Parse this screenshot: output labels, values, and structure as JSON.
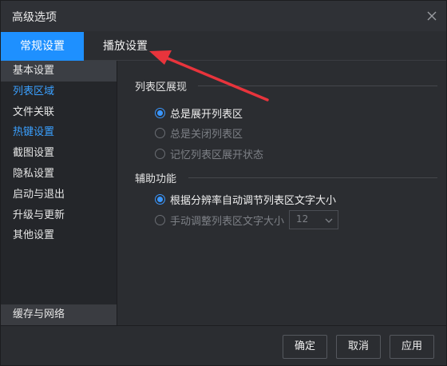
{
  "window": {
    "title": "高级选项"
  },
  "tabs": [
    {
      "label": "常规设置",
      "active": true
    },
    {
      "label": "播放设置",
      "active": false
    }
  ],
  "sidebar": {
    "items": [
      {
        "label": "基本设置"
      },
      {
        "label": "列表区域"
      },
      {
        "label": "文件关联"
      },
      {
        "label": "热键设置"
      },
      {
        "label": "截图设置"
      },
      {
        "label": "隐私设置"
      },
      {
        "label": "启动与退出"
      },
      {
        "label": "升级与更新"
      },
      {
        "label": "其他设置"
      }
    ],
    "bottom_item": "缓存与网络"
  },
  "list_display": {
    "title": "列表区展现",
    "options": [
      {
        "label": "总是展开列表区",
        "checked": true
      },
      {
        "label": "总是关闭列表区",
        "checked": false
      },
      {
        "label": "记忆列表区展开状态",
        "checked": false
      }
    ]
  },
  "assist": {
    "title": "辅助功能",
    "options": [
      {
        "label": "根据分辨率自动调节列表区文字大小",
        "checked": true
      },
      {
        "label": "手动调整列表区文字大小",
        "checked": false
      }
    ],
    "font_size_value": "12"
  },
  "footer": {
    "ok_label": "确定",
    "cancel_label": "取消",
    "apply_label": "应用"
  },
  "colors": {
    "accent": "#1e90ff",
    "annotation": "#e8343c",
    "link_blue": "#3aa0ff"
  }
}
